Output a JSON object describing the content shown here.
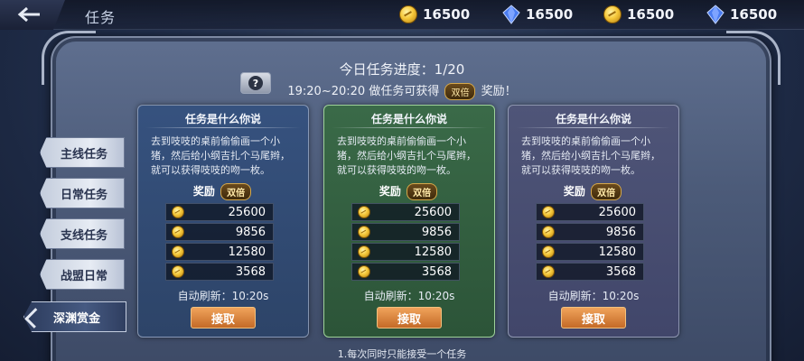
{
  "header": {
    "title": "任务",
    "currencies": [
      {
        "icon": "gold-coin-icon",
        "value": "16500"
      },
      {
        "icon": "blue-gem-icon",
        "value": "16500"
      },
      {
        "icon": "gold-coin-icon",
        "value": "16500"
      },
      {
        "icon": "blue-gem-icon",
        "value": "16500"
      }
    ]
  },
  "progress": {
    "text": "今日任务进度：1/20",
    "time": "19:20~20:20",
    "reward_prefix": "做任务可获得",
    "double_badge": "双倍",
    "reward_suffix": "奖励！"
  },
  "side_tabs": [
    {
      "label": "主线任务",
      "active": false
    },
    {
      "label": "日常任务",
      "active": false
    },
    {
      "label": "支线任务",
      "active": false
    },
    {
      "label": "战盟日常",
      "active": false
    },
    {
      "label": "深渊赏金",
      "active": true
    }
  ],
  "cards": [
    {
      "theme": "blue",
      "title": "任务是什么你说",
      "description": "去到吱吱的桌前偷偷画一个小猪，然后给小纲吉扎个马尾辫，就可以获得吱吱的吻一枚。",
      "reward_label": "奖励",
      "double_badge": "双倍",
      "rewards": [
        "25600",
        "9856",
        "12580",
        "3568"
      ],
      "refresh_label": "自动刷新：",
      "refresh_time": "10:20s",
      "accept_label": "接取"
    },
    {
      "theme": "green",
      "title": "任务是什么你说",
      "description": "去到吱吱的桌前偷偷画一个小猪，然后给小纲吉扎个马尾辫，就可以获得吱吱的吻一枚。",
      "reward_label": "奖励",
      "double_badge": "双倍",
      "rewards": [
        "25600",
        "9856",
        "12580",
        "3568"
      ],
      "refresh_label": "自动刷新：",
      "refresh_time": "10:20s",
      "accept_label": "接取"
    },
    {
      "theme": "purple",
      "title": "任务是什么你说",
      "description": "去到吱吱的桌前偷偷画一个小猪，然后给小纲吉扎个马尾辫，就可以获得吱吱的吻一枚。",
      "reward_label": "奖励",
      "double_badge": "双倍",
      "rewards": [
        "25600",
        "9856",
        "12580",
        "3568"
      ],
      "refresh_label": "自动刷新：",
      "refresh_time": "10:20s",
      "accept_label": "接取"
    }
  ],
  "footnote": "1.每次同时只能接受一个任务",
  "colors": {
    "accent_orange": "#e08a3f",
    "gold": "#f6c93b",
    "gem_blue": "#4a7cf0"
  }
}
